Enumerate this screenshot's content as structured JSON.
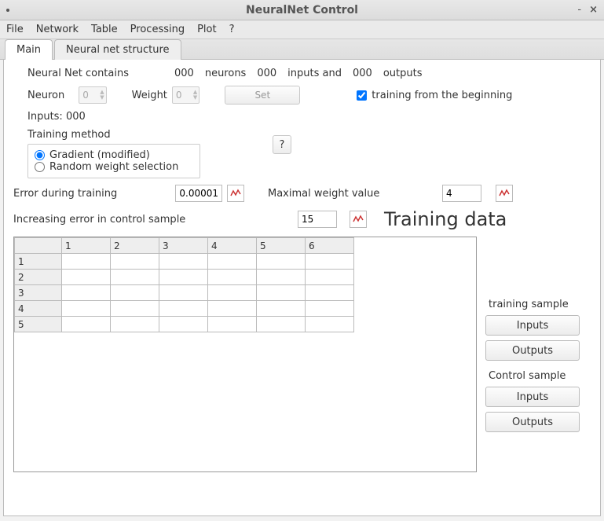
{
  "window": {
    "title": "NeuralNet Control"
  },
  "menu": {
    "file": "File",
    "network": "Network",
    "table": "Table",
    "processing": "Processing",
    "plot": "Plot",
    "help": "?"
  },
  "tabs": {
    "main": "Main",
    "struct": "Neural net structure"
  },
  "summary": {
    "prefix": "Neural Net contains",
    "neurons_count": "000",
    "neurons_label": "neurons",
    "inputs_count": "000",
    "inputs_label": "inputs and",
    "outputs_count": "000",
    "outputs_label": "outputs"
  },
  "neuron": {
    "label": "Neuron",
    "value": "0"
  },
  "weight": {
    "label": "Weight",
    "value": "0"
  },
  "set_button": "Set",
  "training_check": {
    "label": "training from the beginning",
    "checked": true
  },
  "inputs_line": "Inputs: 000",
  "training_method": {
    "label": "Training method",
    "opt1": "Gradient (modified)",
    "opt2": "Random weight selection",
    "help": "?"
  },
  "error_training": {
    "label": "Error during training",
    "value": "0.00001"
  },
  "max_weight": {
    "label": "Maximal weight value",
    "value": "4"
  },
  "incr_error": {
    "label": "Increasing error in control sample",
    "value": "15"
  },
  "training_data_heading": "Training data",
  "table": {
    "cols": [
      "1",
      "2",
      "3",
      "4",
      "5",
      "6"
    ],
    "rows": [
      "1",
      "2",
      "3",
      "4",
      "5"
    ]
  },
  "side": {
    "training_sample": "training sample",
    "control_sample": "Control sample",
    "inputs": "Inputs",
    "outputs": "Outputs"
  }
}
